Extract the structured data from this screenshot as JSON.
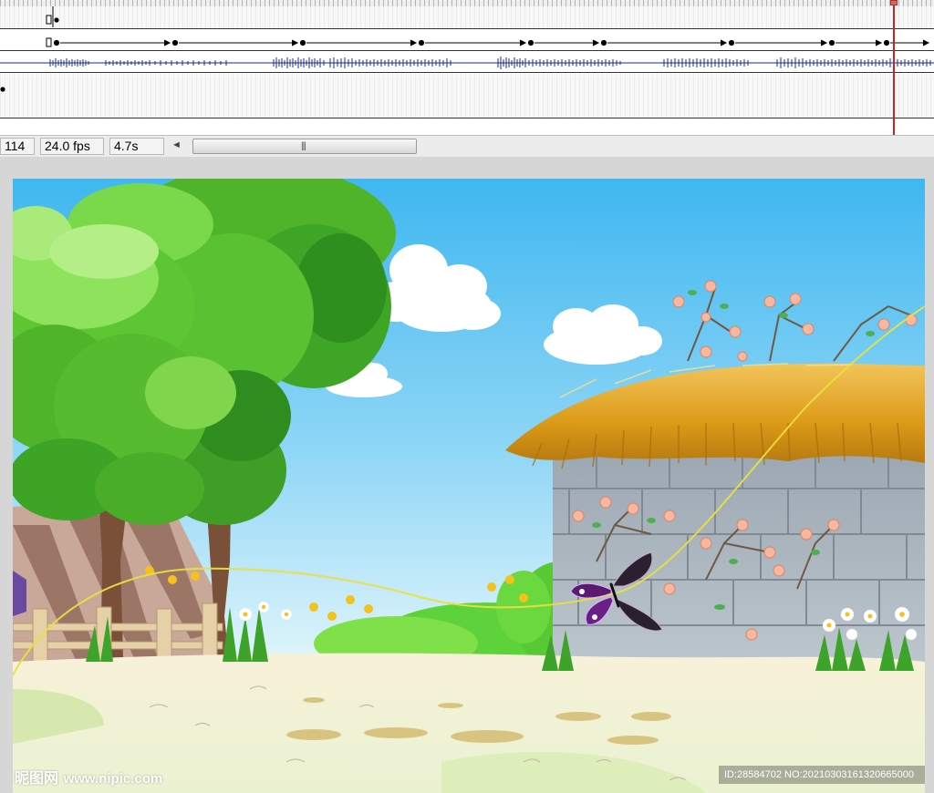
{
  "status_bar": {
    "current_frame": "114",
    "frame_rate": "24.0 fps",
    "elapsed_time": "4.7s",
    "scroll_left_arrow": "◄",
    "scroll_grip": "|||"
  },
  "colors": {
    "playhead": "#cc2222",
    "sky_top": "#3fb7f0",
    "sky_bottom": "#dff4fb",
    "ground": "#f6f1dc",
    "motion_path": "#e8e040",
    "thatch": "#e0a520",
    "stone_wall": "#a9b3bc",
    "tree_green": "#4fc72a"
  },
  "watermark": {
    "site_name": "昵图网",
    "site_url": "www.nipic.com",
    "image_id": "ID:28584702 NO:20210303161320665000"
  }
}
